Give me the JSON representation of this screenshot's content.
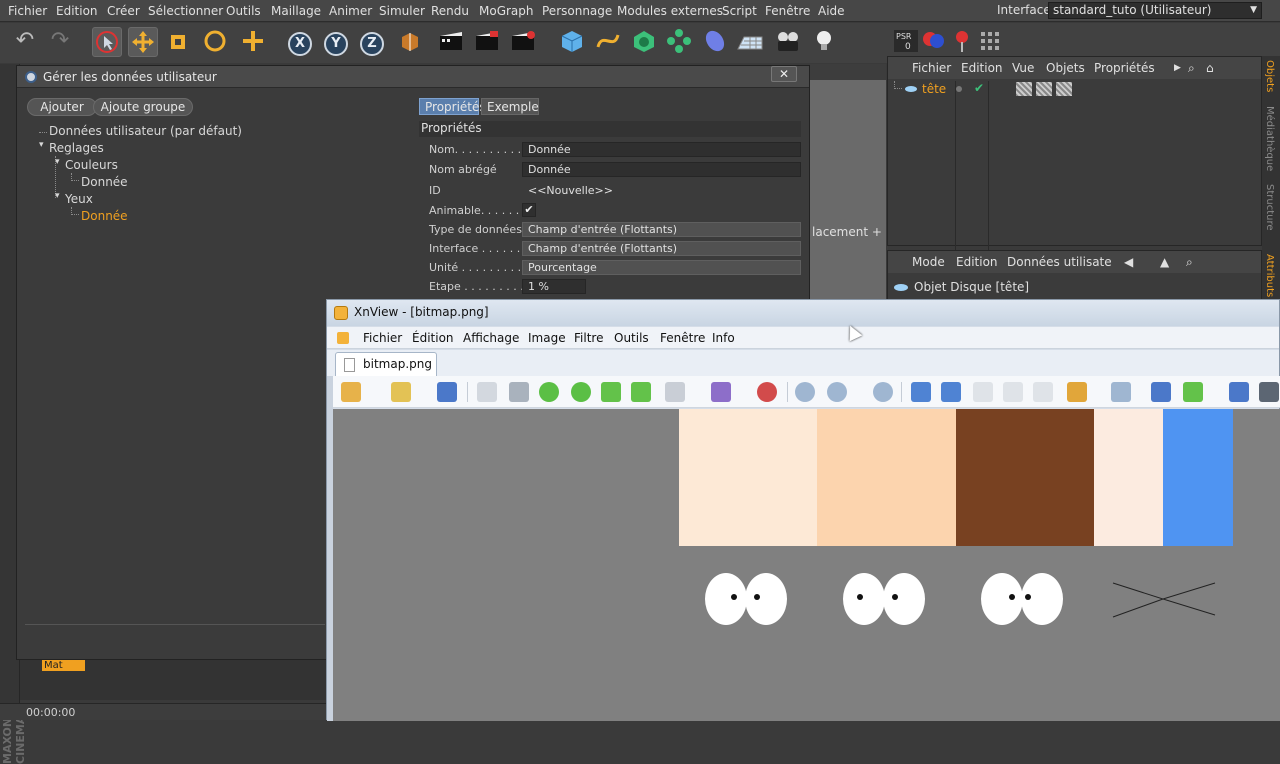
{
  "c4d": {
    "menu": [
      "Fichier",
      "Edition",
      "Créer",
      "Sélectionner",
      "Outils",
      "Maillage",
      "Animer",
      "Simuler",
      "Rendu",
      "MoGraph",
      "Personnage",
      "Modules externes",
      "Script",
      "Fenêtre",
      "Aide"
    ],
    "interface_label": "Interface:",
    "interface_value": "standard_tuto (Utilisateur)",
    "axis_labels": [
      "X",
      "Y",
      "Z"
    ]
  },
  "dialog": {
    "title": "Gérer les données utilisateur",
    "close": "✕",
    "add_button": "Ajouter",
    "add_group_button": "Ajoute groupe",
    "tree": {
      "root": "Données utilisateur (par défaut)",
      "reglages": "Reglages",
      "couleurs": "Couleurs",
      "couleurs_donnee": "Donnée",
      "yeux": "Yeux",
      "yeux_donnee": "Donnée"
    },
    "tabs": [
      "Propriétés",
      "Exemple"
    ],
    "section": "Propriétés",
    "props": [
      {
        "label": "Nom. . . . . . . . . . .",
        "value": "Donnée"
      },
      {
        "label": "Nom abrégé",
        "value": "Donnée"
      },
      {
        "label": "ID",
        "value": "<<Nouvelle>>"
      },
      {
        "label": "Animable. . . . . . .",
        "value": "✔"
      },
      {
        "label": "Type de données",
        "value": "Champ d'entrée (Flottants)"
      },
      {
        "label": "Interface . . . . . . .",
        "value": "Champ d'entrée (Flottants)"
      },
      {
        "label": "Unité . . . . . . . . . .",
        "value": "Pourcentage"
      },
      {
        "label": "Etape . . . . . . . . . .",
        "value": "1 %"
      }
    ]
  },
  "object_manager": {
    "menu": [
      "Fichier",
      "Edition",
      "Vue",
      "Objets",
      "Propriétés"
    ],
    "object_name": "tête"
  },
  "attribute_manager": {
    "menu": [
      "Mode",
      "Edition",
      "Données utilisate"
    ],
    "object_label": "Objet Disque [tête]"
  },
  "right_tabs": [
    "Objets",
    "Médiathèque",
    "Structure",
    "Attributs"
  ],
  "viewport": {
    "placement": "lacement +"
  },
  "xnview": {
    "title": "XnView - [bitmap.png]",
    "menu": [
      "Fichier",
      "Édition",
      "Affichage",
      "Image",
      "Filtre",
      "Outils",
      "Fenêtre",
      "Info"
    ],
    "tab": "bitmap.png",
    "swatch_colors": [
      "#fde9d6",
      "#fcd4ae",
      "#784121",
      "#fcebe0",
      "#4f94f2"
    ]
  },
  "timeline": {
    "material": "Mat",
    "time": "00:00:00"
  },
  "branding": "MAXON CINEMA"
}
